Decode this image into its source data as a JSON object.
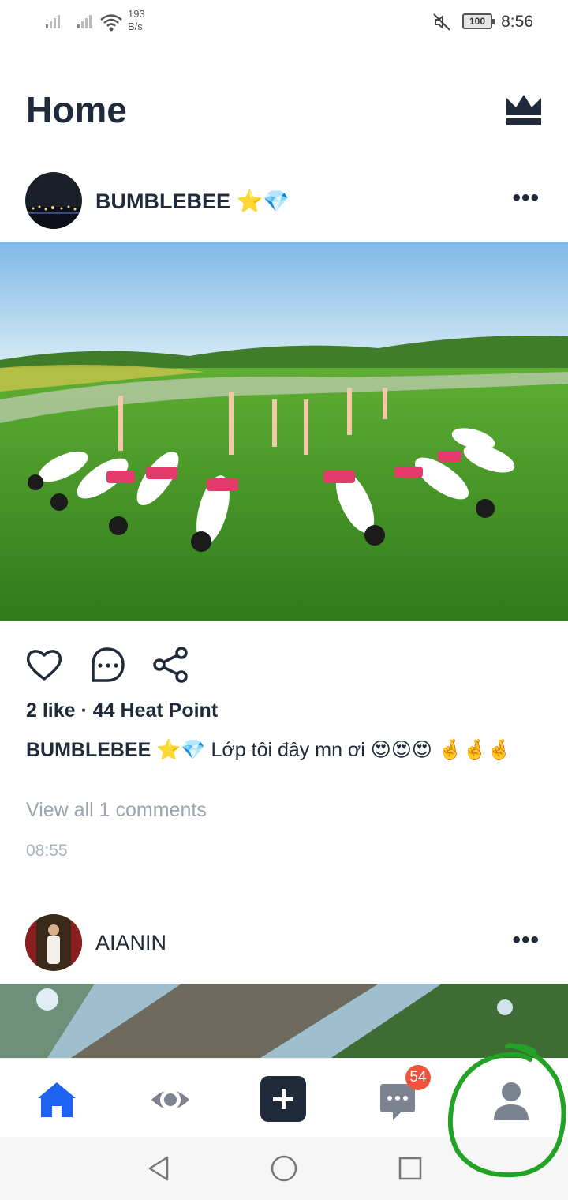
{
  "status_bar": {
    "net_speed_value": "193",
    "net_speed_unit": "B/s",
    "battery": "100",
    "time": "8:56"
  },
  "header": {
    "title": "Home",
    "premium_icon": "crown-icon"
  },
  "posts": [
    {
      "username": "BUMBLEBEE ⭐💎",
      "stats": "2 like · 44 Heat Point",
      "caption_user": "BUMBLEBEE ⭐💎",
      "caption_text": " Lớp tôi đây mn ơi 😍😍😍 🤞🤞🤞",
      "view_comments": "View all 1 comments",
      "timestamp": "08:55"
    },
    {
      "username": "AIANIN"
    }
  ],
  "bottom_nav": {
    "messages_badge": "54",
    "items": [
      "home-icon",
      "eye-icon",
      "plus-icon",
      "chat-icon",
      "profile-icon"
    ]
  },
  "colors": {
    "accent": "#1e63f0",
    "text": "#1f2a3a",
    "badge": "#f0533c",
    "annotation": "#22a325"
  }
}
